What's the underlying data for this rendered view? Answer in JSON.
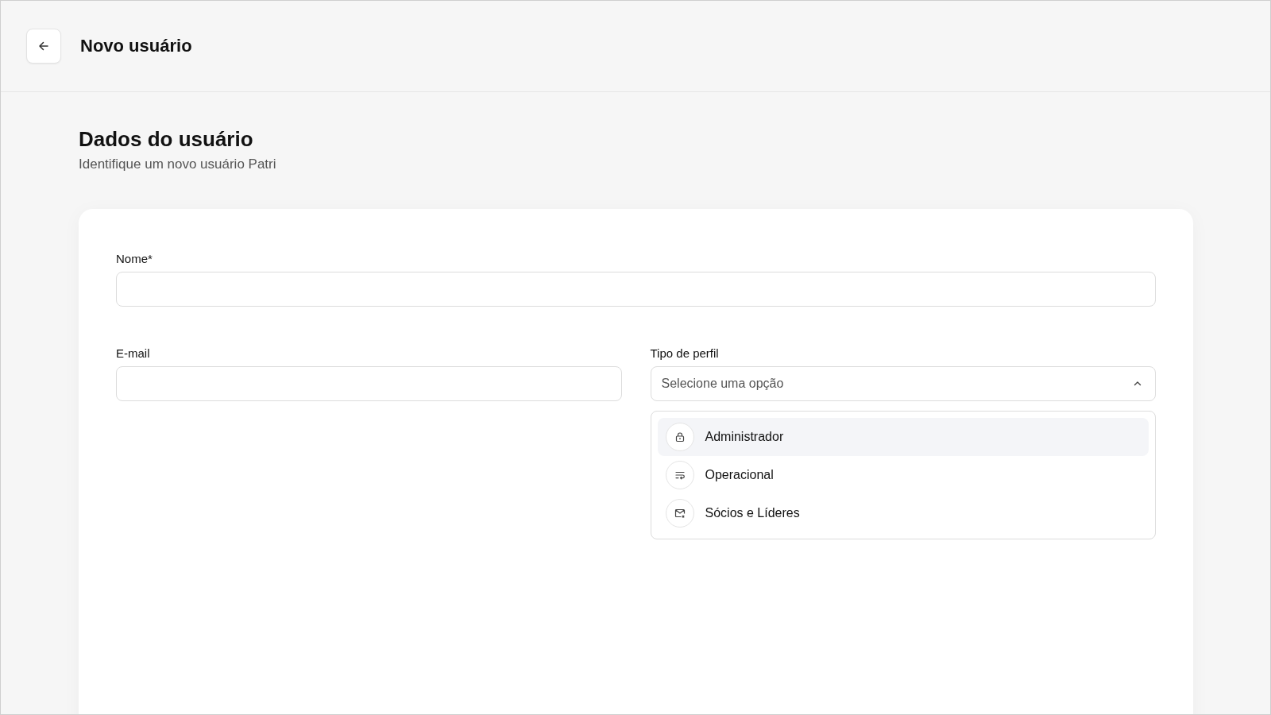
{
  "header": {
    "title": "Novo usuário"
  },
  "section": {
    "title": "Dados do usuário",
    "subtitle": "Identifique um novo usuário Patri"
  },
  "form": {
    "name_field": {
      "label": "Nome*"
    },
    "email_field": {
      "label": "E-mail"
    },
    "profile_select": {
      "label": "Tipo de perfil",
      "placeholder": "Selecione uma opção",
      "expanded": true,
      "options": [
        {
          "label": "Administrador",
          "kind": "lock",
          "selected": true
        },
        {
          "label": "Operacional",
          "kind": "wrap",
          "selected": false
        },
        {
          "label": "Sócios e Líderes",
          "kind": "mail",
          "selected": false
        }
      ]
    }
  }
}
